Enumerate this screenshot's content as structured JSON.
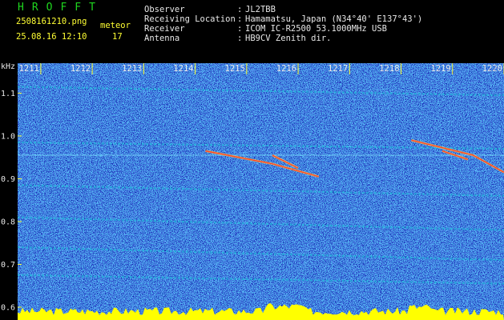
{
  "header": {
    "brand": "HROFFT",
    "filename": "2508161210.png",
    "date_time": "25.08.16 12:10",
    "meteor_label": "meteor",
    "meteor_count": "17",
    "info": [
      {
        "label": "Observer",
        "value": "JL2TBB"
      },
      {
        "label": "Receiving Location",
        "value": "Hamamatsu, Japan (N34°40' E137°43')"
      },
      {
        "label": "Receiver",
        "value": "ICOM IC-R2500 53.1000MHz USB"
      },
      {
        "label": "Antenna",
        "value": "HB9CV Zenith dir."
      }
    ]
  },
  "chart_data": {
    "type": "heatmap",
    "x_ticks": [
      "1211",
      "1212",
      "1213",
      "1214",
      "1215",
      "1216",
      "1217",
      "1218",
      "1219",
      "1220"
    ],
    "y_unit": "kHz",
    "y_ticks": [
      "1.1",
      "1.0",
      "0.9",
      "0.8",
      "0.7",
      "0.6"
    ],
    "y_tick_values": [
      1.1,
      1.0,
      0.9,
      0.8,
      0.7,
      0.6
    ],
    "ylim": [
      0.57,
      1.17
    ],
    "xlim": [
      1210.55,
      1220.0
    ],
    "colors": {
      "background": "#0a18a8",
      "noise_high": "#19c6d8",
      "noise_mid": "#1a5ff0",
      "signal": "#ff3a2a",
      "tick": "#ffff33",
      "bottom_band": "#ffff00"
    },
    "meteor_traces": [
      {
        "x": [
          1214.2,
          1215.5,
          1216.4
        ],
        "y": [
          0.965,
          0.935,
          0.905
        ]
      },
      {
        "x": [
          1215.5,
          1216.0
        ],
        "y": [
          0.955,
          0.925
        ]
      },
      {
        "x": [
          1218.2,
          1219.4,
          1220.0
        ],
        "y": [
          0.99,
          0.955,
          0.915
        ]
      },
      {
        "x": [
          1218.8,
          1219.3
        ],
        "y": [
          0.965,
          0.945
        ]
      }
    ],
    "drift_lines": [
      {
        "x": [
          1210.55,
          1220.0
        ],
        "y": [
          1.115,
          1.095
        ]
      },
      {
        "x": [
          1210.55,
          1220.0
        ],
        "y": [
          0.985,
          0.97
        ]
      },
      {
        "x": [
          1210.55,
          1220.0
        ],
        "y": [
          0.885,
          0.86
        ]
      },
      {
        "x": [
          1210.55,
          1220.0
        ],
        "y": [
          0.81,
          0.78
        ]
      },
      {
        "x": [
          1210.55,
          1220.0
        ],
        "y": [
          0.74,
          0.71
        ]
      },
      {
        "x": [
          1210.55,
          1220.0
        ],
        "y": [
          0.675,
          0.655
        ]
      }
    ],
    "carrier_line": {
      "y": 0.955
    }
  }
}
